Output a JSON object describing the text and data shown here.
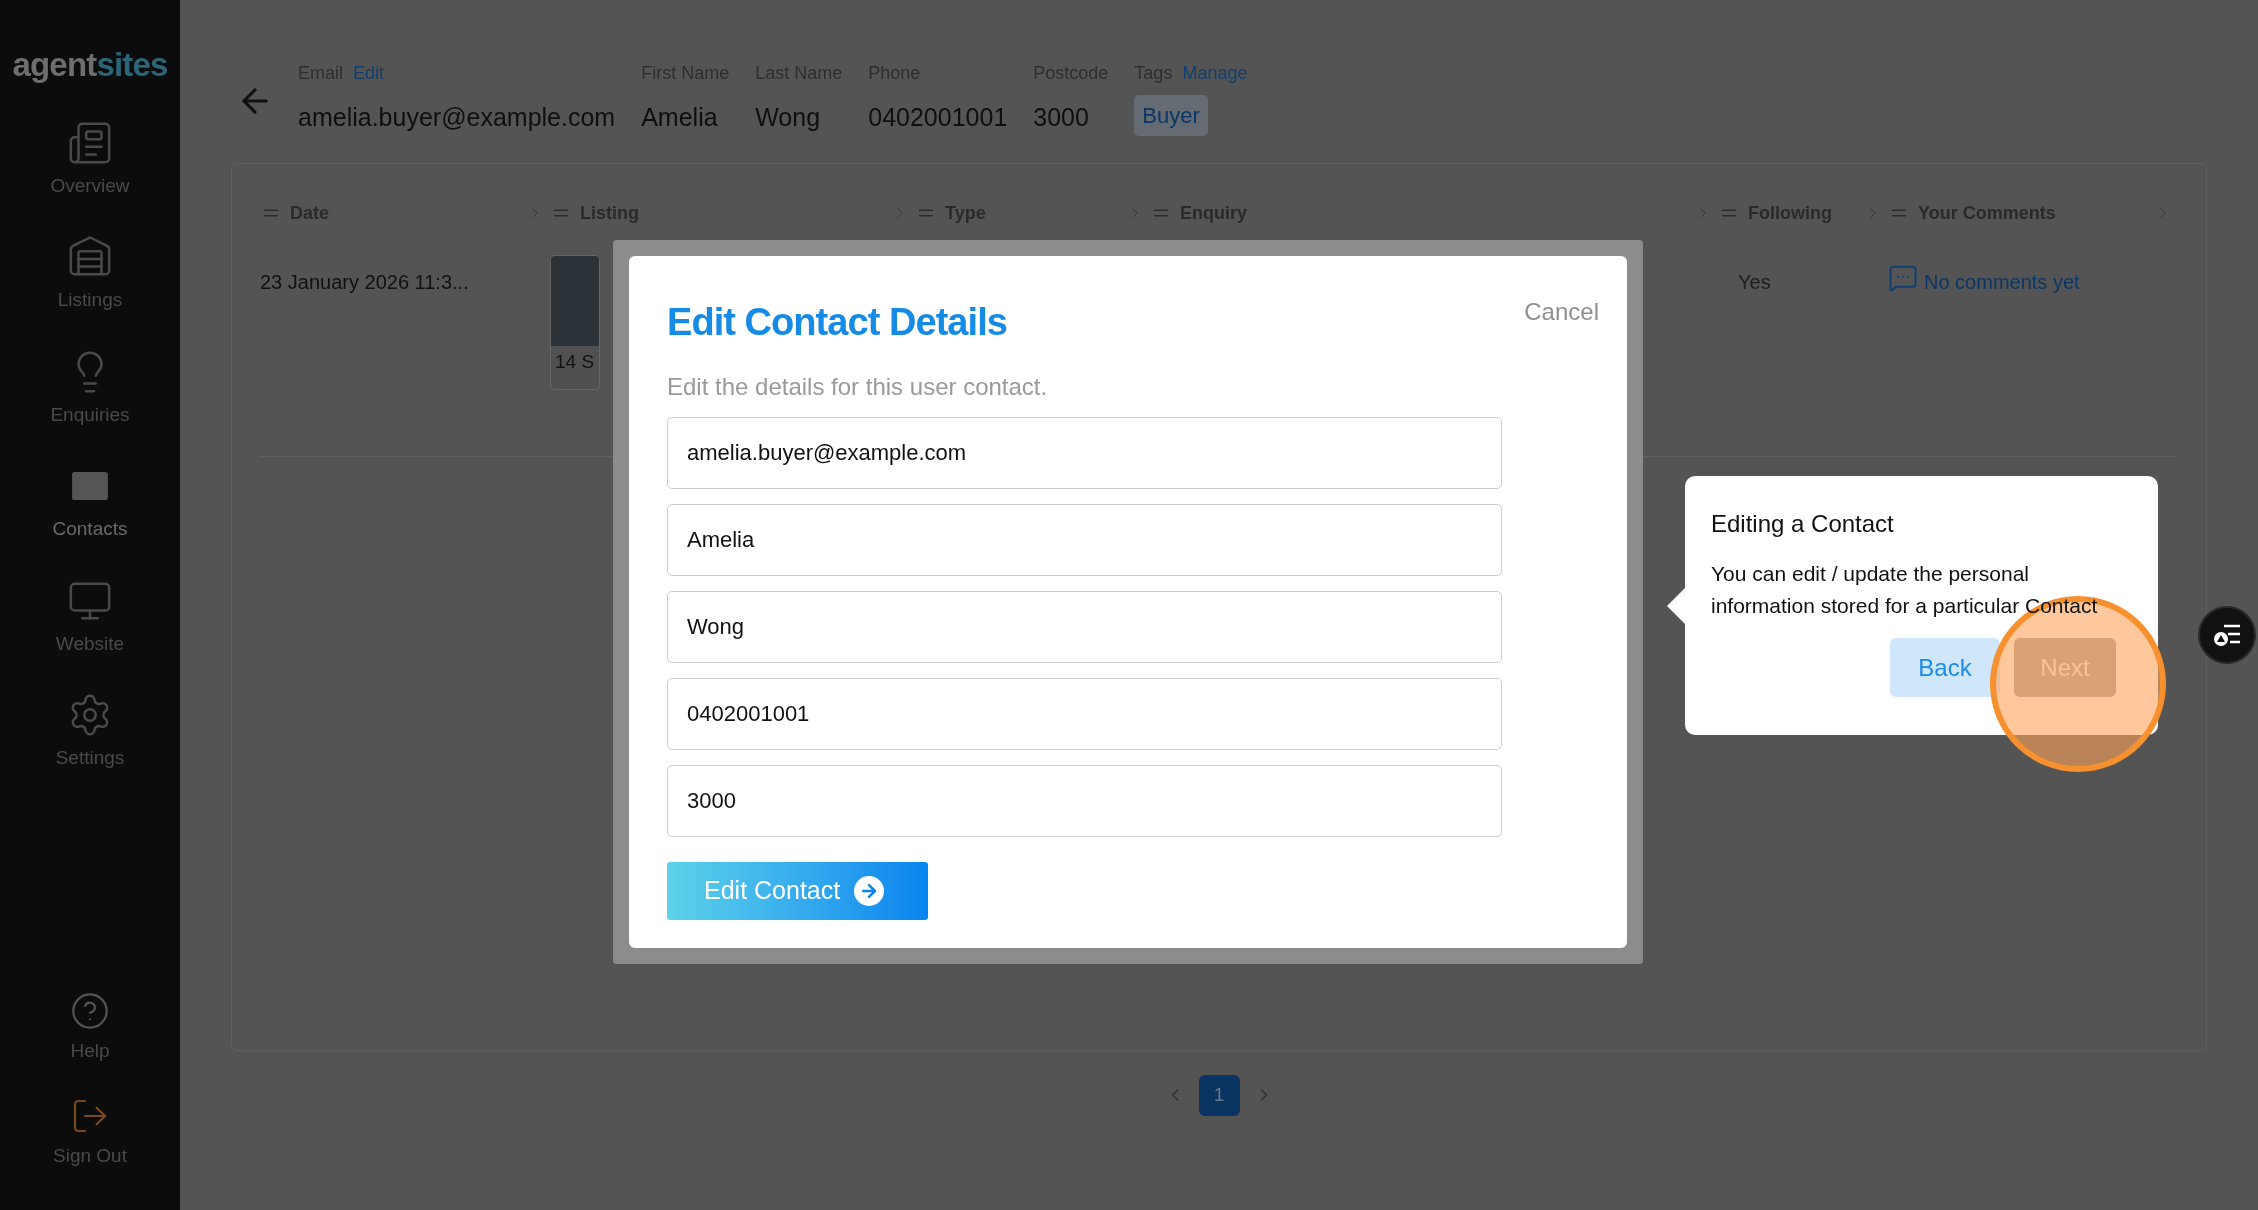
{
  "sidebar": {
    "logo": {
      "part_1": "agent",
      "part_2": "sites"
    },
    "items": [
      {
        "label": "Overview",
        "selected": false
      },
      {
        "label": "Listings",
        "selected": false
      },
      {
        "label": "Enquiries",
        "selected": false
      },
      {
        "label": "Contacts",
        "selected": true
      },
      {
        "label": "Website",
        "selected": false
      },
      {
        "label": "Settings",
        "selected": false
      }
    ],
    "bottom_items": [
      {
        "label": "Help"
      },
      {
        "label": "Sign Out"
      }
    ]
  },
  "header": {
    "fields": [
      {
        "label": "Email",
        "link": "Edit",
        "value": "amelia.buyer@example.com"
      },
      {
        "label": "First Name",
        "value": "Amelia"
      },
      {
        "label": "Last Name",
        "value": "Wong"
      },
      {
        "label": "Phone",
        "value": "0402001001"
      },
      {
        "label": "Postcode",
        "value": "3000"
      }
    ],
    "tags": {
      "label": "Tags",
      "link": "Manage",
      "items": [
        "Buyer"
      ]
    }
  },
  "table": {
    "columns": [
      "Date",
      "Listing",
      "Type",
      "Enquiry",
      "Following",
      "Your Comments"
    ],
    "rows": [
      {
        "date": "23 January 2026 11:3...",
        "listing": "14 S",
        "following": "Yes",
        "comments": "No comments yet"
      }
    ]
  },
  "pagination": {
    "pages": [
      {
        "label": "1",
        "selected": true
      }
    ]
  },
  "modal": {
    "title": "Edit Contact Details",
    "cancel": "Cancel",
    "subtitle": "Edit the details for this user contact.",
    "fields": [
      "amelia.buyer@example.com",
      "Amelia",
      "Wong",
      "0402001001",
      "3000"
    ],
    "submit": "Edit Contact"
  },
  "tour": {
    "title": "Editing a Contact",
    "body": "You can edit / update the personal information stored for a particular Contact",
    "back": "Back",
    "next": "Next"
  }
}
